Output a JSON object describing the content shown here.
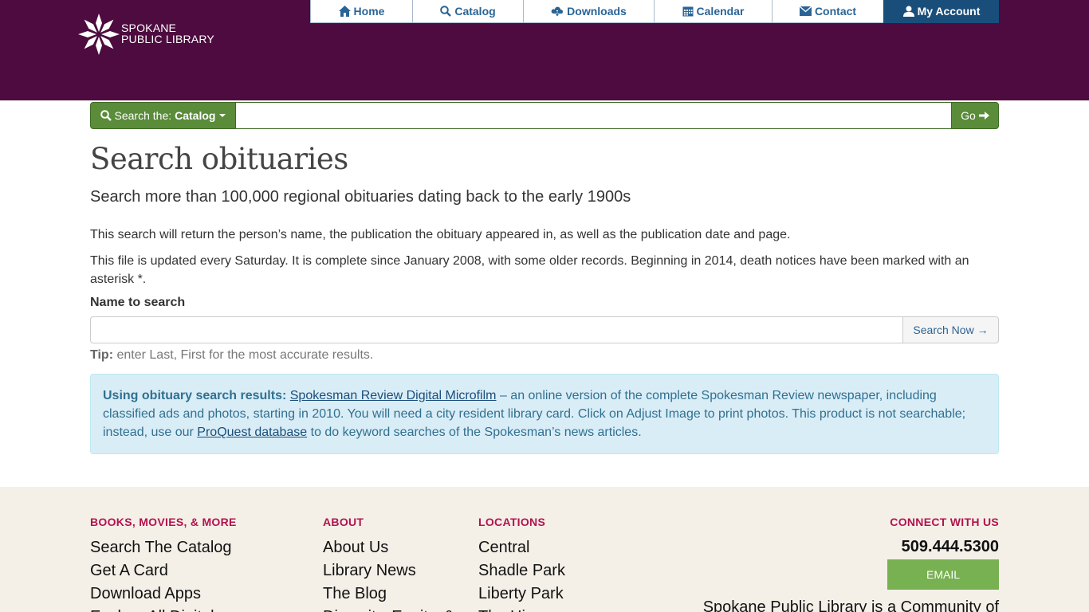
{
  "header": {
    "logo_line1": "SPOKANE",
    "logo_line2": "PUBLIC LIBRARY",
    "bg_color": "#4d0b3f"
  },
  "nav": [
    {
      "label": "Home",
      "icon": "home-icon"
    },
    {
      "label": "Catalog",
      "icon": "search-icon"
    },
    {
      "label": "Downloads",
      "icon": "cloud-download-icon"
    },
    {
      "label": "Calendar",
      "icon": "calendar-icon"
    },
    {
      "label": "Contact",
      "icon": "envelope-icon"
    },
    {
      "label": "My Account",
      "icon": "user-icon",
      "active": true
    }
  ],
  "search": {
    "prefix": "Search the:",
    "scope": "Catalog",
    "value": "",
    "go_label": "Go"
  },
  "main": {
    "title": "Search obituaries",
    "subtitle": "Search more than 100,000 regional obituaries dating back to the early 1900s",
    "para1": "This search will return the person’s name, the publication the obituary appeared in, as well as the publication date and page.",
    "para2": "This file is updated every Saturday. It is complete since January 2008, with some older records. Beginning in 2014, death notices have been marked with an asterisk *.",
    "name_label": "Name to search",
    "name_value": "",
    "search_now_label": "Search Now →",
    "tip_label": "Tip:",
    "tip_text": " enter Last, First for the most accurate results."
  },
  "infobox": {
    "lead": "Using obituary search results:",
    "link1": "Spokesman Review Digital Microfilm",
    "text1": " – an online version of the complete Spokesman Review newspaper, including classified ads and photos, starting in 2010.  You will need a city resident library card. Click on Adjust Image to print photos. This product is not searchable; instead, use our ",
    "link2": "ProQuest database",
    "text2": " to do keyword searches of the Spokesman’s news articles."
  },
  "footer": {
    "col1": {
      "heading": "BOOKS, MOVIES, & MORE",
      "links": [
        "Search The Catalog",
        "Get A Card",
        "Download Apps",
        "Explore All Digital"
      ]
    },
    "col2": {
      "heading": "ABOUT",
      "links": [
        "About Us",
        "Library News",
        "The Blog",
        "Diversity, Equity, &"
      ]
    },
    "col3": {
      "heading": "LOCATIONS",
      "links": [
        "Central",
        "Shadle Park",
        "Liberty Park",
        "The Hive"
      ]
    },
    "connect": {
      "heading": "CONNECT WITH US",
      "phone": "509.444.5300",
      "email_label": "EMAIL",
      "community": "Spokane Public Library is a Community of"
    }
  }
}
